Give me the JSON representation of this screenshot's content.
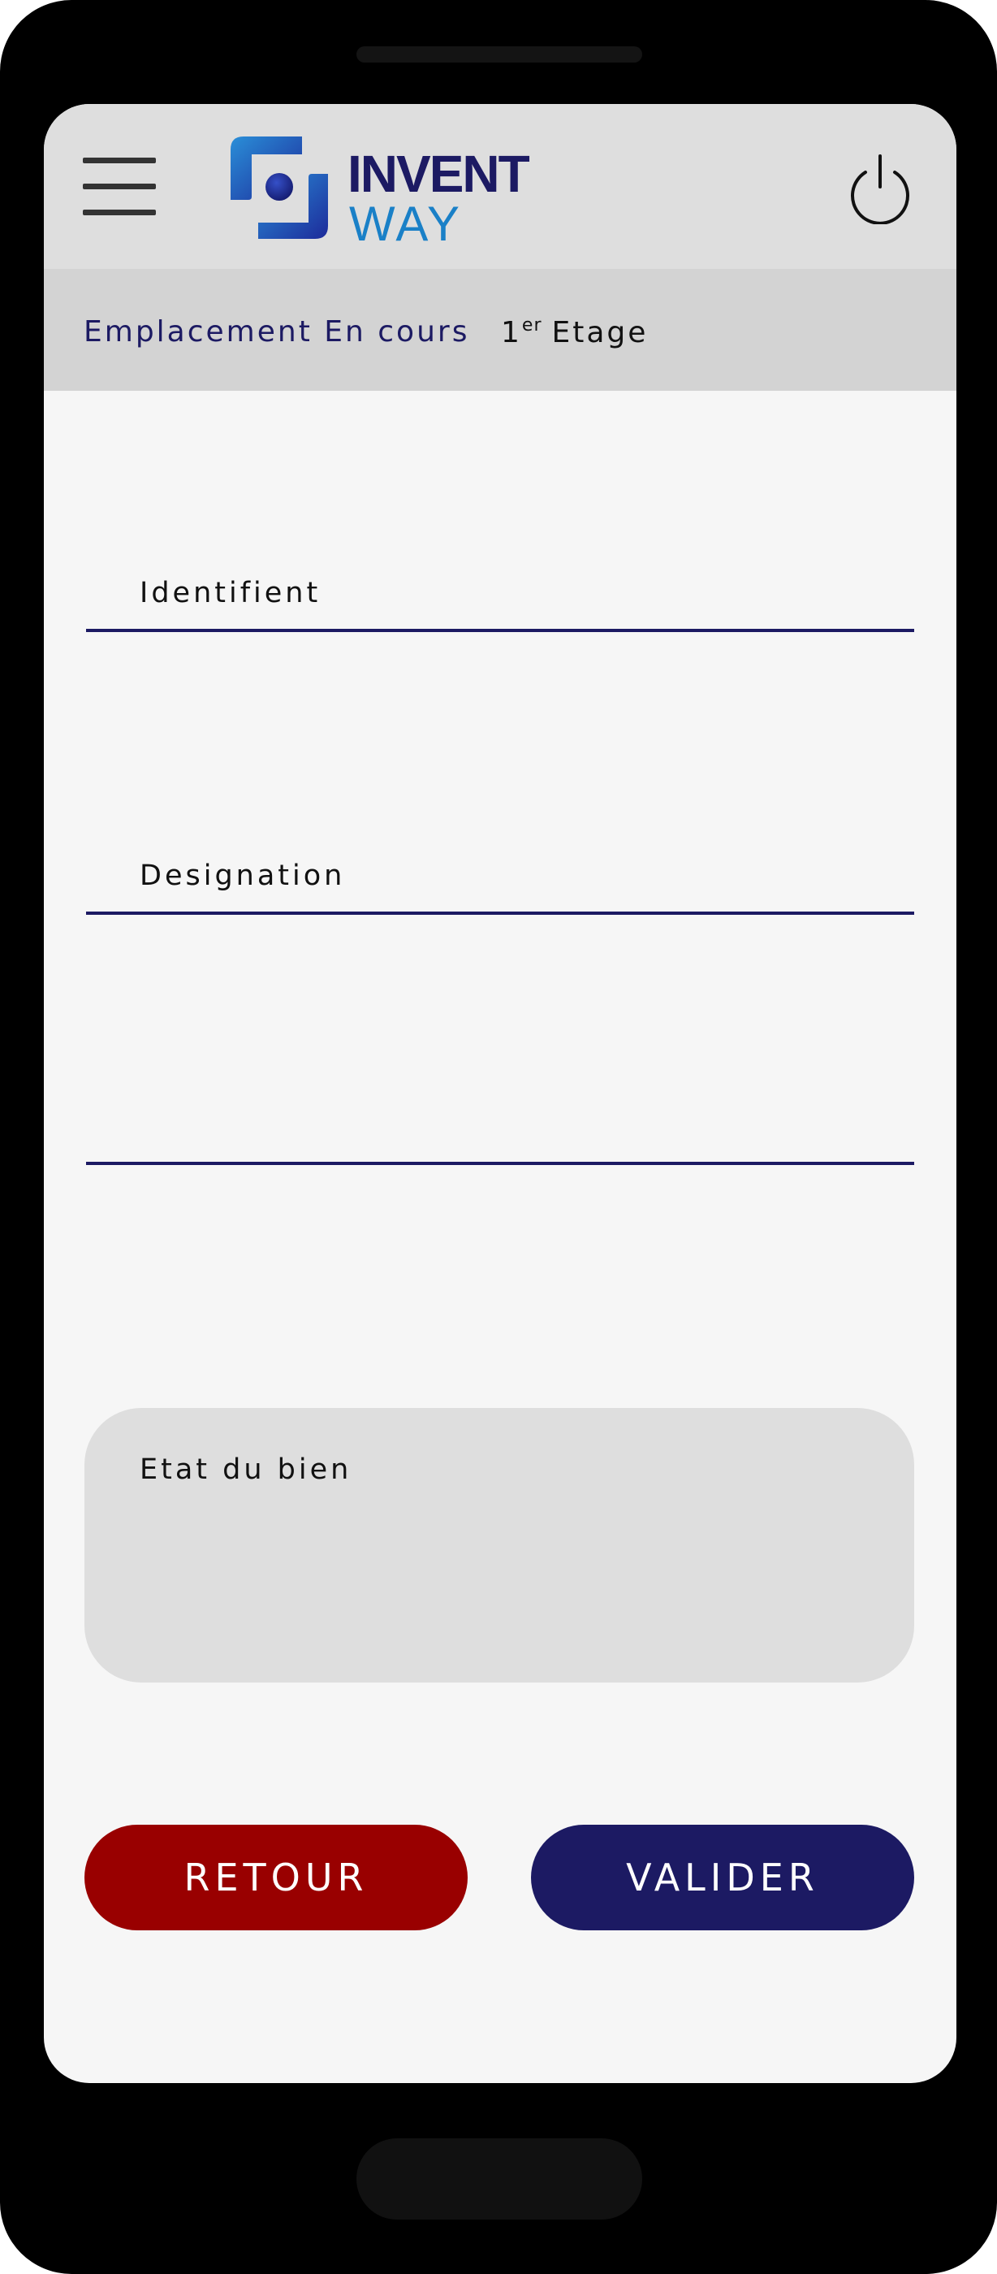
{
  "header": {
    "logo": {
      "line1": "INVENT",
      "line2": "WAY",
      "colors": {
        "primary": "#1c1a63",
        "secondary": "#1a80c7",
        "mark_light": "#2a8fd8",
        "mark_dark": "#1d2a9a"
      }
    },
    "menu_icon": "hamburger-menu-icon",
    "power_icon": "power-icon"
  },
  "location": {
    "label": "Emplacement En cours",
    "floor_number": "1",
    "floor_superscript": "er",
    "floor_name": "Etage"
  },
  "form": {
    "identifiant_label": "Identifient",
    "designation_label": "Designation",
    "etat_label": "Etat du bien"
  },
  "buttons": {
    "retour": "RETOUR",
    "valider": "VALIDER"
  },
  "colors": {
    "header_bg": "#dedede",
    "location_bg": "#d3d3d3",
    "screen_bg": "#f6f6f6",
    "accent": "#1c1a63",
    "retour_bg": "#990000",
    "valider_bg": "#1c1a63"
  }
}
